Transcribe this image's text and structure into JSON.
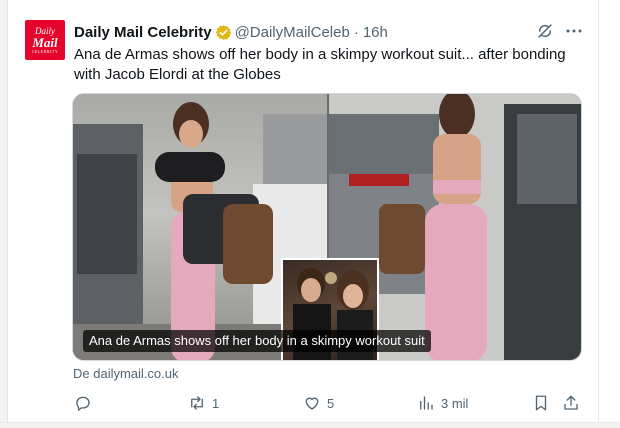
{
  "tweet": {
    "avatar": {
      "line1": "Daily",
      "line2": "Mail",
      "line3": "CELEBRITY"
    },
    "display_name": "Daily Mail Celebrity",
    "handle": "@DailyMailCeleb",
    "separator": "·",
    "time": "16h",
    "text": "Ana de Armas shows off her body in a skimpy workout suit... after bonding with Jacob Elordi at the Globes",
    "media_caption": "Ana de Armas shows off her body in a skimpy workout suit",
    "source": "De dailymail.co.uk"
  },
  "actions": {
    "reply_count": "",
    "retweet_count": "1",
    "like_count": "5",
    "views_count": "3 mil"
  },
  "colors": {
    "brand_red": "#e4042c",
    "verified_gold": "#e2b719",
    "muted_text": "#536471"
  },
  "icons": [
    "verified-badge-icon",
    "grok-icon",
    "more-icon",
    "reply-icon",
    "retweet-icon",
    "like-icon",
    "views-icon",
    "bookmark-icon",
    "share-icon"
  ]
}
